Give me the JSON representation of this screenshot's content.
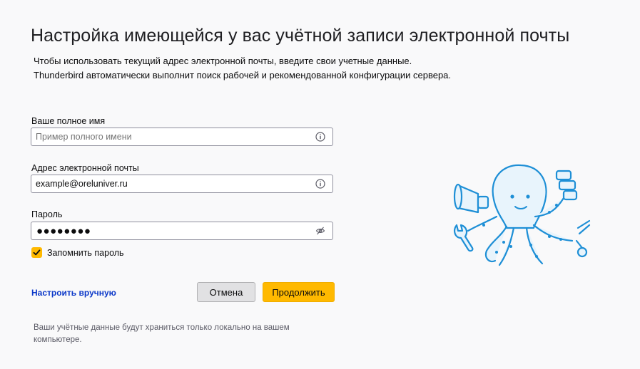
{
  "header": {
    "title": "Настройка имеющейся у вас учётной записи электронной почты",
    "description_line1": "Чтобы использовать текущий адрес электронной почты, введите свои учетные данные.",
    "description_line2": "Thunderbird автоматически выполнит поиск рабочей и рекомендованной конфигурации сервера."
  },
  "form": {
    "name_label": "Ваше полное имя",
    "name_placeholder": "Пример полного имени",
    "name_value": "",
    "email_label": "Адрес электронной почты",
    "email_value": "example@oreluniver.ru",
    "password_label": "Пароль",
    "password_masked": "●●●●●●●●",
    "remember_label": "Запомнить пароль",
    "remember_checked": true
  },
  "actions": {
    "manual_label": "Настроить вручную",
    "cancel_label": "Отмена",
    "continue_label": "Продолжить"
  },
  "footer": {
    "note": "Ваши учётные данные будут храниться только локально на вашем компьютере."
  },
  "icons": {
    "name_info": "info-icon",
    "email_info": "info-icon",
    "password_toggle": "eye-slash-icon",
    "mascot": "octopus-mascot"
  },
  "colors": {
    "accent": "#ffb900",
    "link": "#0a37c8",
    "mascot_blue": "#1e8fd6"
  }
}
